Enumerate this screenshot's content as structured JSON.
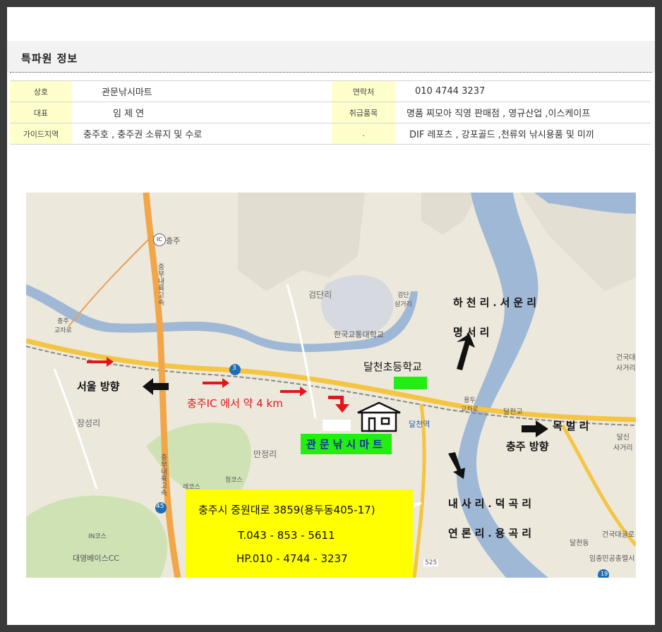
{
  "section_title": "특파원 정보",
  "info_rows": [
    {
      "label1": "상호",
      "value1": "관문낚시마트",
      "label2": "연락처",
      "value2": "010  4744  3237"
    },
    {
      "label1": "대표",
      "value1": "임 제 연",
      "label2": "취급품목",
      "value2": "명품 찌모아 직영 판매점 , 영규산업 ,이스케이프"
    },
    {
      "label1": "가이드지역",
      "value1": "충주호 , 충주권 소류지 및 수로",
      "label2": ".",
      "value2": "DIF 레포츠 , 강포골드 ,천류외 낚시용품 및 미끼"
    }
  ],
  "map": {
    "places": {
      "ic": "충주",
      "ic_badge": "IC",
      "expressway": "중부내륙고속",
      "expressway2": "중부내륙고속",
      "chungju_crossroad": "충주\n교차로",
      "geomdanri": "검단리",
      "geomdan_crossroad": "검단\n삼거리",
      "university": "한국교통대학교",
      "school": "달천초등학교",
      "yongdu_crossroad": "용두\n교차로",
      "dalcheon_bridge": "달천교",
      "station": "달천역",
      "jangseongri": "장성리",
      "manjeongri": "만정리",
      "course_blue": "청코스",
      "course_red": "레코스",
      "course_in": "IN코스",
      "golf": "대영베이스CC",
      "dalsin": "달신\n사거리",
      "geonguk_sagri": "건국대\n사거리",
      "geonguk_univ": "건국대글로",
      "dalcheondong": "달천동",
      "imchung": "임충민공충렬시",
      "road3": "3",
      "road45": "45",
      "road525": "525",
      "road19": "19"
    },
    "directions": {
      "to_seoul": "서울 방향",
      "to_chungju": "충주 방향",
      "from_ic": "충주IC 에서 약 4 km",
      "north_1": "하천리.서운리",
      "north_2": "명서리",
      "east": "목벌리",
      "south_1": "내사리.덕곡리",
      "south_2": "연론리.용곡리"
    },
    "store_name": "관문낚시마트",
    "address": "충주시 중원대로 3859(용두동405-17)",
    "tel": "T.043 - 853 - 5611",
    "hp": "HP.010 - 4744 - 3237"
  },
  "colors": {
    "label_bg": "#ffffcc",
    "store_tag": "#22ee11",
    "info_box": "#ffff00",
    "arrow_red": "#e0171b"
  }
}
